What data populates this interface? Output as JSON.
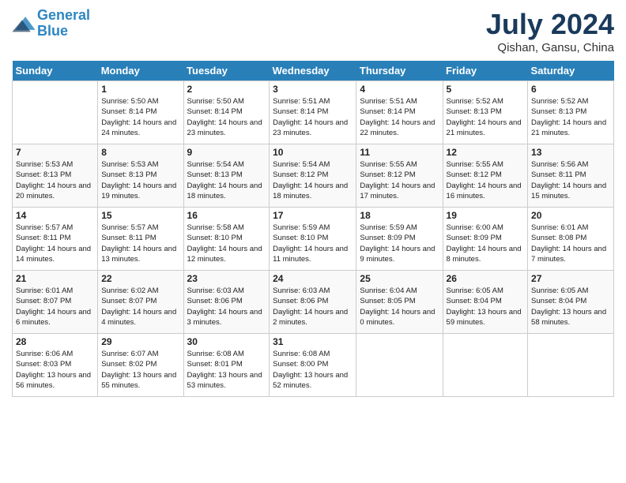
{
  "header": {
    "logo_line1": "General",
    "logo_line2": "Blue",
    "month": "July 2024",
    "location": "Qishan, Gansu, China"
  },
  "weekdays": [
    "Sunday",
    "Monday",
    "Tuesday",
    "Wednesday",
    "Thursday",
    "Friday",
    "Saturday"
  ],
  "weeks": [
    [
      {
        "day": "",
        "sunrise": "",
        "sunset": "",
        "daylight": ""
      },
      {
        "day": "1",
        "sunrise": "Sunrise: 5:50 AM",
        "sunset": "Sunset: 8:14 PM",
        "daylight": "Daylight: 14 hours and 24 minutes."
      },
      {
        "day": "2",
        "sunrise": "Sunrise: 5:50 AM",
        "sunset": "Sunset: 8:14 PM",
        "daylight": "Daylight: 14 hours and 23 minutes."
      },
      {
        "day": "3",
        "sunrise": "Sunrise: 5:51 AM",
        "sunset": "Sunset: 8:14 PM",
        "daylight": "Daylight: 14 hours and 23 minutes."
      },
      {
        "day": "4",
        "sunrise": "Sunrise: 5:51 AM",
        "sunset": "Sunset: 8:14 PM",
        "daylight": "Daylight: 14 hours and 22 minutes."
      },
      {
        "day": "5",
        "sunrise": "Sunrise: 5:52 AM",
        "sunset": "Sunset: 8:13 PM",
        "daylight": "Daylight: 14 hours and 21 minutes."
      },
      {
        "day": "6",
        "sunrise": "Sunrise: 5:52 AM",
        "sunset": "Sunset: 8:13 PM",
        "daylight": "Daylight: 14 hours and 21 minutes."
      }
    ],
    [
      {
        "day": "7",
        "sunrise": "Sunrise: 5:53 AM",
        "sunset": "Sunset: 8:13 PM",
        "daylight": "Daylight: 14 hours and 20 minutes."
      },
      {
        "day": "8",
        "sunrise": "Sunrise: 5:53 AM",
        "sunset": "Sunset: 8:13 PM",
        "daylight": "Daylight: 14 hours and 19 minutes."
      },
      {
        "day": "9",
        "sunrise": "Sunrise: 5:54 AM",
        "sunset": "Sunset: 8:13 PM",
        "daylight": "Daylight: 14 hours and 18 minutes."
      },
      {
        "day": "10",
        "sunrise": "Sunrise: 5:54 AM",
        "sunset": "Sunset: 8:12 PM",
        "daylight": "Daylight: 14 hours and 18 minutes."
      },
      {
        "day": "11",
        "sunrise": "Sunrise: 5:55 AM",
        "sunset": "Sunset: 8:12 PM",
        "daylight": "Daylight: 14 hours and 17 minutes."
      },
      {
        "day": "12",
        "sunrise": "Sunrise: 5:55 AM",
        "sunset": "Sunset: 8:12 PM",
        "daylight": "Daylight: 14 hours and 16 minutes."
      },
      {
        "day": "13",
        "sunrise": "Sunrise: 5:56 AM",
        "sunset": "Sunset: 8:11 PM",
        "daylight": "Daylight: 14 hours and 15 minutes."
      }
    ],
    [
      {
        "day": "14",
        "sunrise": "Sunrise: 5:57 AM",
        "sunset": "Sunset: 8:11 PM",
        "daylight": "Daylight: 14 hours and 14 minutes."
      },
      {
        "day": "15",
        "sunrise": "Sunrise: 5:57 AM",
        "sunset": "Sunset: 8:11 PM",
        "daylight": "Daylight: 14 hours and 13 minutes."
      },
      {
        "day": "16",
        "sunrise": "Sunrise: 5:58 AM",
        "sunset": "Sunset: 8:10 PM",
        "daylight": "Daylight: 14 hours and 12 minutes."
      },
      {
        "day": "17",
        "sunrise": "Sunrise: 5:59 AM",
        "sunset": "Sunset: 8:10 PM",
        "daylight": "Daylight: 14 hours and 11 minutes."
      },
      {
        "day": "18",
        "sunrise": "Sunrise: 5:59 AM",
        "sunset": "Sunset: 8:09 PM",
        "daylight": "Daylight: 14 hours and 9 minutes."
      },
      {
        "day": "19",
        "sunrise": "Sunrise: 6:00 AM",
        "sunset": "Sunset: 8:09 PM",
        "daylight": "Daylight: 14 hours and 8 minutes."
      },
      {
        "day": "20",
        "sunrise": "Sunrise: 6:01 AM",
        "sunset": "Sunset: 8:08 PM",
        "daylight": "Daylight: 14 hours and 7 minutes."
      }
    ],
    [
      {
        "day": "21",
        "sunrise": "Sunrise: 6:01 AM",
        "sunset": "Sunset: 8:07 PM",
        "daylight": "Daylight: 14 hours and 6 minutes."
      },
      {
        "day": "22",
        "sunrise": "Sunrise: 6:02 AM",
        "sunset": "Sunset: 8:07 PM",
        "daylight": "Daylight: 14 hours and 4 minutes."
      },
      {
        "day": "23",
        "sunrise": "Sunrise: 6:03 AM",
        "sunset": "Sunset: 8:06 PM",
        "daylight": "Daylight: 14 hours and 3 minutes."
      },
      {
        "day": "24",
        "sunrise": "Sunrise: 6:03 AM",
        "sunset": "Sunset: 8:06 PM",
        "daylight": "Daylight: 14 hours and 2 minutes."
      },
      {
        "day": "25",
        "sunrise": "Sunrise: 6:04 AM",
        "sunset": "Sunset: 8:05 PM",
        "daylight": "Daylight: 14 hours and 0 minutes."
      },
      {
        "day": "26",
        "sunrise": "Sunrise: 6:05 AM",
        "sunset": "Sunset: 8:04 PM",
        "daylight": "Daylight: 13 hours and 59 minutes."
      },
      {
        "day": "27",
        "sunrise": "Sunrise: 6:05 AM",
        "sunset": "Sunset: 8:04 PM",
        "daylight": "Daylight: 13 hours and 58 minutes."
      }
    ],
    [
      {
        "day": "28",
        "sunrise": "Sunrise: 6:06 AM",
        "sunset": "Sunset: 8:03 PM",
        "daylight": "Daylight: 13 hours and 56 minutes."
      },
      {
        "day": "29",
        "sunrise": "Sunrise: 6:07 AM",
        "sunset": "Sunset: 8:02 PM",
        "daylight": "Daylight: 13 hours and 55 minutes."
      },
      {
        "day": "30",
        "sunrise": "Sunrise: 6:08 AM",
        "sunset": "Sunset: 8:01 PM",
        "daylight": "Daylight: 13 hours and 53 minutes."
      },
      {
        "day": "31",
        "sunrise": "Sunrise: 6:08 AM",
        "sunset": "Sunset: 8:00 PM",
        "daylight": "Daylight: 13 hours and 52 minutes."
      },
      {
        "day": "",
        "sunrise": "",
        "sunset": "",
        "daylight": ""
      },
      {
        "day": "",
        "sunrise": "",
        "sunset": "",
        "daylight": ""
      },
      {
        "day": "",
        "sunrise": "",
        "sunset": "",
        "daylight": ""
      }
    ]
  ]
}
